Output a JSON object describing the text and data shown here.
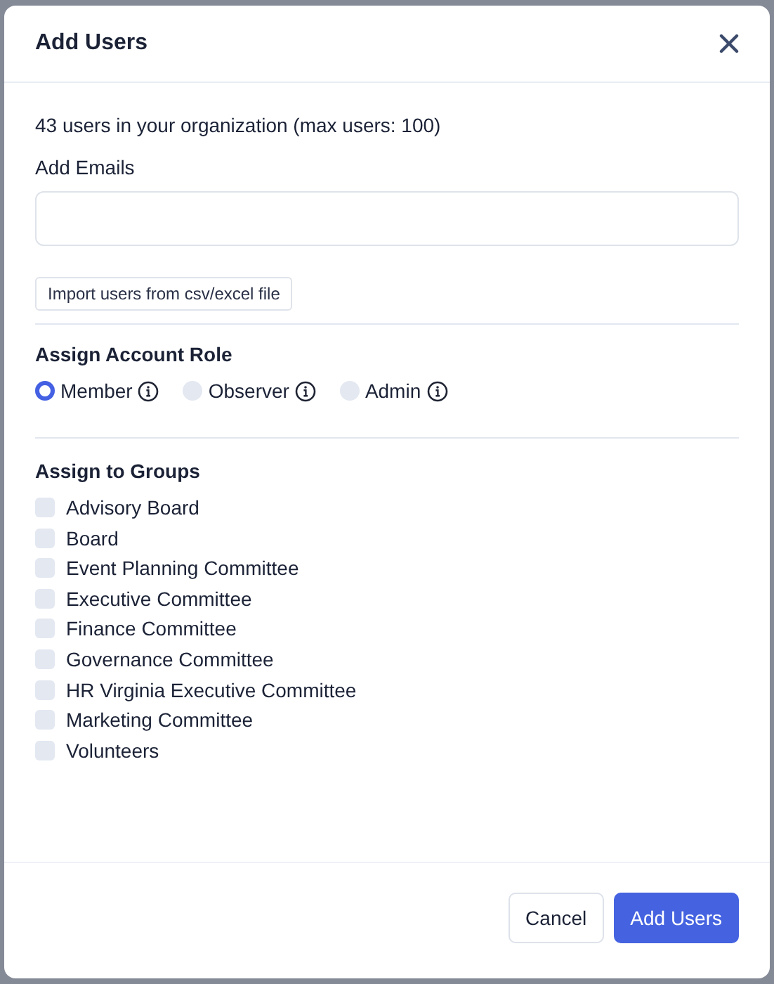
{
  "dialog": {
    "title": "Add Users",
    "summary": "43 users in your organization (max users: 100)"
  },
  "emails": {
    "label": "Add Emails"
  },
  "import_button": "Import users from csv/excel file",
  "role": {
    "heading": "Assign Account Role",
    "options": [
      {
        "label": "Member",
        "selected": true
      },
      {
        "label": "Observer",
        "selected": false
      },
      {
        "label": "Admin",
        "selected": false
      }
    ]
  },
  "groups": {
    "heading": "Assign to Groups",
    "items": [
      {
        "label": "Advisory Board",
        "checked": false
      },
      {
        "label": "Board",
        "checked": false
      },
      {
        "label": "Event Planning Committee",
        "checked": false
      },
      {
        "label": "Executive Committee",
        "checked": false
      },
      {
        "label": "Finance Committee",
        "checked": false
      },
      {
        "label": "Governance Committee",
        "checked": false
      },
      {
        "label": "HR Virginia Executive Committee",
        "checked": false
      },
      {
        "label": "Marketing Committee",
        "checked": false
      },
      {
        "label": "Volunteers",
        "checked": false
      }
    ]
  },
  "buttons": {
    "cancel": "Cancel",
    "submit": "Add Users"
  }
}
